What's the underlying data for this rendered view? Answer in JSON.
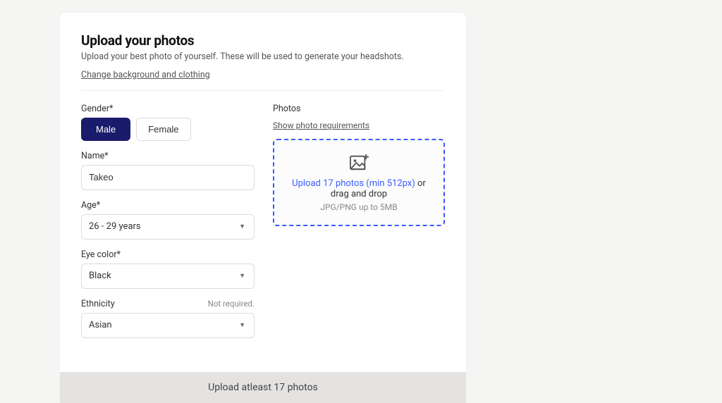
{
  "header": {
    "title": "Upload your photos",
    "subtitle": "Upload your best photo of yourself. These will be used to generate your headshots.",
    "change_link": "Change background and clothing"
  },
  "form": {
    "gender": {
      "label": "Gender*",
      "male": "Male",
      "female": "Female"
    },
    "name": {
      "label": "Name*",
      "value": "Takeo"
    },
    "age": {
      "label": "Age*",
      "value": "26 - 29 years"
    },
    "eye": {
      "label": "Eye color*",
      "value": "Black"
    },
    "ethnicity": {
      "label": "Ethnicity",
      "not_required": "Not required.",
      "value": "Asian"
    }
  },
  "photos": {
    "label": "Photos",
    "requirements_link": "Show photo requirements",
    "drop_link_text": "Upload 17 photos (min 512px)",
    "drop_or": " or drag and drop",
    "drop_hint": "JPG/PNG up to 5MB"
  },
  "footer": {
    "button": "Upload atleast 17 photos"
  }
}
